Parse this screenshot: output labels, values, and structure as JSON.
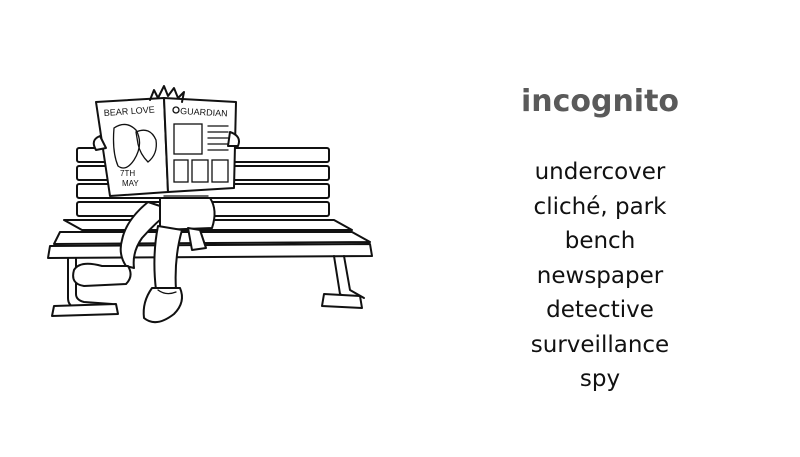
{
  "title": "incognito",
  "words": [
    "undercover",
    "cliché, park",
    "bench",
    "newspaper",
    "detective",
    "surveillance",
    "spy"
  ],
  "newspaper": {
    "left_headline": "BEAR LOVE",
    "masthead": "GUARDIAN",
    "date_line1": "7TH",
    "date_line2": "MAY"
  },
  "colors": {
    "title": "#5a5a5a",
    "text": "#111111",
    "background": "#ffffff"
  }
}
